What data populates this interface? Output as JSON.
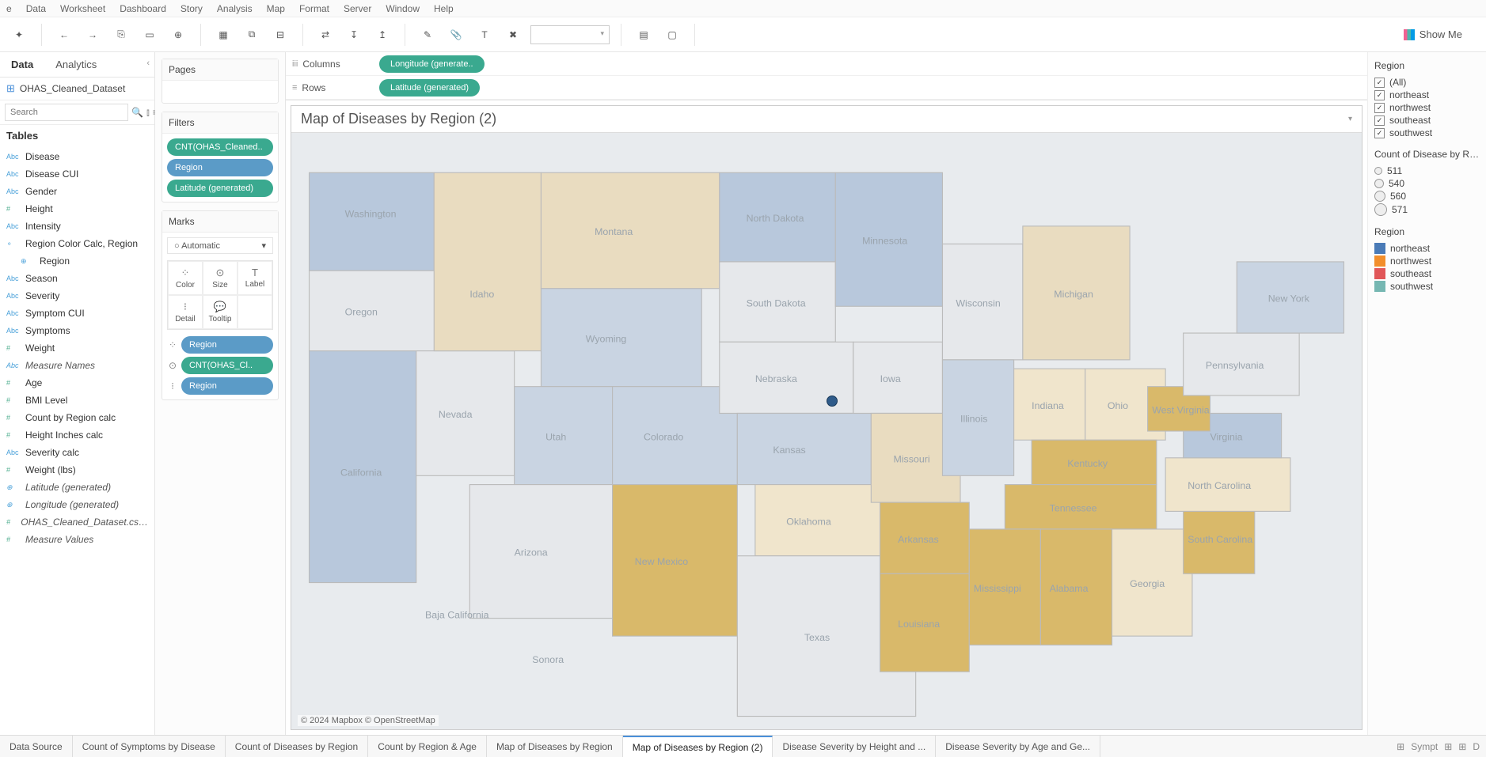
{
  "menu": [
    "e",
    "Data",
    "Worksheet",
    "Dashboard",
    "Story",
    "Analysis",
    "Map",
    "Format",
    "Server",
    "Window",
    "Help"
  ],
  "showme_label": "Show Me",
  "sidepane": {
    "tabs": {
      "data": "Data",
      "analytics": "Analytics"
    },
    "datasource": "OHAS_Cleaned_Dataset",
    "search_placeholder": "Search",
    "tables_header": "Tables",
    "fields": [
      {
        "type": "Abc",
        "label": "Disease"
      },
      {
        "type": "Abc",
        "label": "Disease CUI"
      },
      {
        "type": "Abc",
        "label": "Gender"
      },
      {
        "type": "#",
        "label": "Height",
        "num": true
      },
      {
        "type": "Abc",
        "label": "Intensity"
      },
      {
        "type": "hier",
        "label": "Region Color Calc, Region"
      },
      {
        "type": "geo",
        "label": "Region",
        "indent": true
      },
      {
        "type": "Abc",
        "label": "Season"
      },
      {
        "type": "Abc",
        "label": "Severity"
      },
      {
        "type": "Abc",
        "label": "Symptom CUI"
      },
      {
        "type": "Abc",
        "label": "Symptoms"
      },
      {
        "type": "#",
        "label": "Weight",
        "num": true
      },
      {
        "type": "Abc",
        "label": "Measure Names",
        "italic": true
      },
      {
        "type": "#",
        "label": "Age",
        "num": true
      },
      {
        "type": "#",
        "label": "BMI Level",
        "num": true
      },
      {
        "type": "#",
        "label": "Count by Region calc",
        "num": true
      },
      {
        "type": "#",
        "label": "Height Inches calc",
        "num": true
      },
      {
        "type": "Abc",
        "label": "Severity calc"
      },
      {
        "type": "#",
        "label": "Weight (lbs)",
        "num": true
      },
      {
        "type": "geo",
        "label": "Latitude (generated)",
        "italic": true
      },
      {
        "type": "geo",
        "label": "Longitude (generated)",
        "italic": true
      },
      {
        "type": "#",
        "label": "OHAS_Cleaned_Dataset.cs…",
        "italic": true,
        "num": true
      },
      {
        "type": "#",
        "label": "Measure Values",
        "italic": true,
        "num": true
      }
    ]
  },
  "shelves": {
    "pages": "Pages",
    "filters": "Filters",
    "filter_pills": [
      {
        "label": "CNT(OHAS_Cleaned..",
        "cls": "green"
      },
      {
        "label": "Region",
        "cls": "blue"
      },
      {
        "label": "Latitude (generated)",
        "cls": "green"
      }
    ],
    "marks": "Marks",
    "marks_type": "Automatic",
    "marks_buttons": [
      "Color",
      "Size",
      "Label",
      "Detail",
      "Tooltip"
    ],
    "marks_pills": [
      {
        "icon": "color",
        "label": "Region",
        "cls": "blue"
      },
      {
        "icon": "size",
        "label": "CNT(OHAS_Cl..",
        "cls": "green"
      },
      {
        "icon": "detail",
        "label": "Region",
        "cls": "blue"
      }
    ]
  },
  "rowscols": {
    "columns_label": "Columns",
    "rows_label": "Rows",
    "columns_pill": "Longitude (generate..",
    "rows_pill": "Latitude (generated)"
  },
  "viz": {
    "title": "Map of Diseases by Region (2)",
    "attribution": "© 2024 Mapbox © OpenStreetMap",
    "states": [
      "Washington",
      "Oregon",
      "California",
      "Nevada",
      "Idaho",
      "Montana",
      "Wyoming",
      "Utah",
      "Arizona",
      "Colorado",
      "New Mexico",
      "North Dakota",
      "South Dakota",
      "Nebraska",
      "Kansas",
      "Oklahoma",
      "Texas",
      "Minnesota",
      "Iowa",
      "Missouri",
      "Arkansas",
      "Louisiana",
      "Wisconsin",
      "Illinois",
      "Michigan",
      "Indiana",
      "Ohio",
      "Kentucky",
      "Tennessee",
      "Mississippi",
      "Alabama",
      "Georgia",
      "South Carolina",
      "North Carolina",
      "Virginia",
      "West Virginia",
      "Pennsylvania",
      "New York",
      "Baja California",
      "Sonora"
    ]
  },
  "legends": {
    "region_filter": {
      "title": "Region",
      "items": [
        "(All)",
        "northeast",
        "northwest",
        "southeast",
        "southwest"
      ]
    },
    "count": {
      "title": "Count of Disease by Re..",
      "items": [
        "511",
        "540",
        "560",
        "571"
      ]
    },
    "region_color": {
      "title": "Region",
      "items": [
        {
          "label": "northeast",
          "color": "#4a7bb7"
        },
        {
          "label": "northwest",
          "color": "#f28e2b"
        },
        {
          "label": "southeast",
          "color": "#e15759"
        },
        {
          "label": "southwest",
          "color": "#76b7b2"
        }
      ]
    }
  },
  "sheets": {
    "data_source": "Data Source",
    "tabs": [
      "Count of Symptoms by Disease",
      "Count of Diseases by Region",
      "Count by Region & Age",
      "Map of Diseases by Region",
      "Map of Diseases by Region (2)",
      "Disease Severity by Height and ...",
      "Disease Severity by Age and Ge..."
    ],
    "active": "Map of Diseases by Region (2)",
    "trailing": "Sympt"
  }
}
